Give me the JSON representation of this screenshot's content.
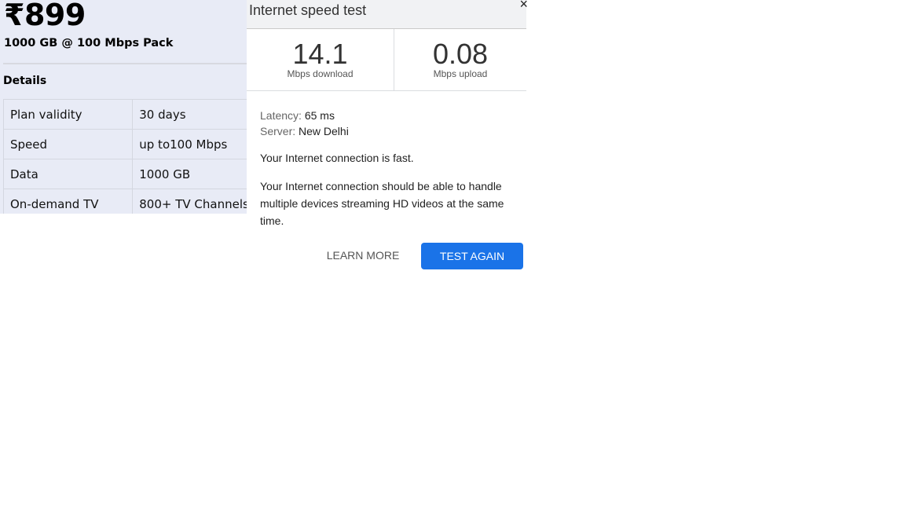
{
  "plan": {
    "price": "₹899",
    "pack_name": "1000 GB @ 100 Mbps Pack",
    "details_heading": "Details",
    "details": [
      {
        "key": "Plan validity",
        "value": "30 days"
      },
      {
        "key": "Speed",
        "value": "up to100 Mbps"
      },
      {
        "key": "Data",
        "value": "1000 GB"
      },
      {
        "key": "On-demand TV",
        "value": "800+ TV Channels"
      }
    ]
  },
  "speed_test": {
    "title": "Internet speed test",
    "close_glyph": "×",
    "download": {
      "value": "14.1",
      "unit": "Mbps download"
    },
    "upload": {
      "value": "0.08",
      "unit": "Mbps upload"
    },
    "latency_label": "Latency:",
    "latency_value": "65 ms",
    "server_label": "Server:",
    "server_value": "New Delhi",
    "status": "Your Internet connection is fast.",
    "description": "Your Internet connection should be able to handle multiple devices streaming HD videos at the same time.",
    "learn_more_label": "LEARN MORE",
    "test_again_label": "TEST AGAIN",
    "accent_color": "#1a73e8"
  }
}
